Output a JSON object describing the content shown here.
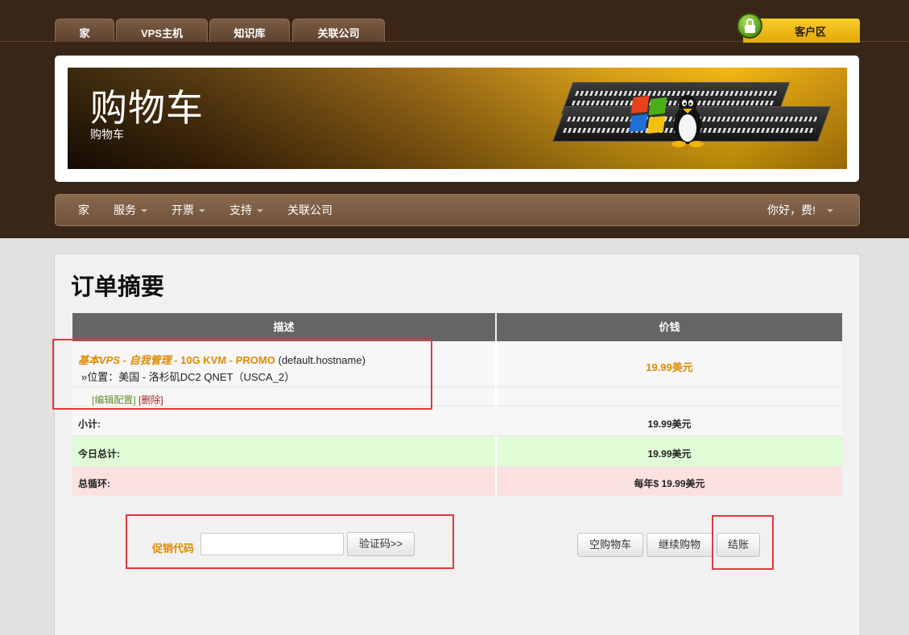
{
  "top_tabs": [
    "家",
    "VPS主机",
    "知识库",
    "关联公司"
  ],
  "client_area": "客户区",
  "banner": {
    "title": "购物车",
    "subtitle": "购物车"
  },
  "nav": {
    "home": "家",
    "services": "服务",
    "billing": "开票",
    "support": "支持",
    "affiliates": "关联公司",
    "greeting": "你好，费!"
  },
  "order": {
    "title": "订单摘要",
    "col_description": "描述",
    "col_price": "价钱",
    "item": {
      "name": "基本VPS - 自我管理 - ",
      "name_tail": "10G KVM - PROMO",
      "hostname": "(default.hostname)",
      "location": "»位置：美国 - 洛杉矶DC2 QNET（USCA_2）",
      "edit_link": "[编辑配置]",
      "remove_link": "[删除]",
      "price": "19.99美元"
    },
    "subtotal_label": "小计:",
    "subtotal_value": "19.99美元",
    "today_label": "今日总计:",
    "today_value": "19.99美元",
    "recurring_label": "总循环:",
    "recurring_value": "每年$ 19.99美元"
  },
  "promo": {
    "label": "促销代码",
    "input_value": "",
    "validate_button": "验证码>>"
  },
  "actions": {
    "empty_cart": "空购物车",
    "continue_shopping": "继续购物",
    "checkout": "结账"
  },
  "colors": {
    "accent_orange": "#e08a00",
    "highlight_red": "#e03b3b",
    "header_brown": "#3a2616"
  }
}
